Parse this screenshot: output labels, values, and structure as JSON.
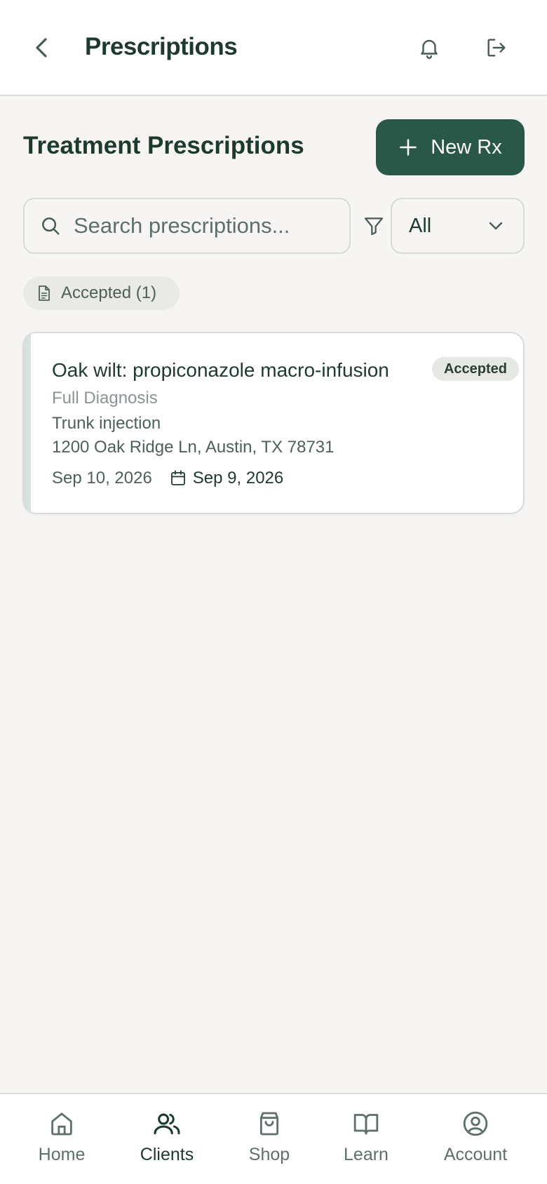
{
  "header": {
    "title": "Prescriptions",
    "back_icon": "chevron-left-icon",
    "notification_icon": "bell-icon",
    "logout_icon": "logout-icon"
  },
  "section": {
    "title": "Treatment Prescriptions",
    "new_button_label": "New Rx"
  },
  "search": {
    "placeholder": "Search prescriptions...",
    "value": ""
  },
  "filter": {
    "selected": "All"
  },
  "chip": {
    "label": "Accepted (1)"
  },
  "prescriptions": [
    {
      "title": "Oak wilt: propiconazole macro-infusion",
      "status": "Accepted",
      "category": "Full Diagnosis",
      "method": "Trunk injection",
      "address": "1200 Oak Ridge Ln, Austin, TX 78731",
      "created_date": "Sep 10, 2026",
      "scheduled_date": "Sep 9, 2026"
    }
  ],
  "bottom_nav": {
    "items": [
      {
        "label": "Home",
        "icon": "home-icon",
        "active": false
      },
      {
        "label": "Clients",
        "icon": "users-icon",
        "active": true
      },
      {
        "label": "Shop",
        "icon": "shopping-bag-icon",
        "active": false
      },
      {
        "label": "Learn",
        "icon": "book-icon",
        "active": false
      },
      {
        "label": "Account",
        "icon": "user-circle-icon",
        "active": false
      }
    ]
  },
  "colors": {
    "primary": "#2a5848",
    "text_dark": "#1e3a2f",
    "background": "#f6f5f3",
    "muted_text": "#5f6f69"
  }
}
